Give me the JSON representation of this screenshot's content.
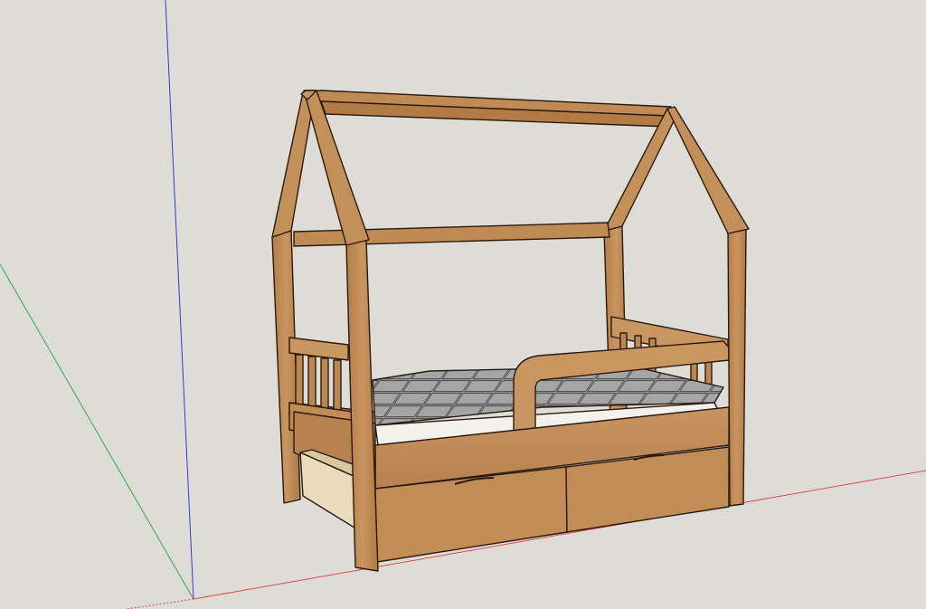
{
  "viewport": {
    "background": "#dddcd7"
  },
  "axes": {
    "x_color": "#d94b4b",
    "y_color": "#3aa64a",
    "z_color": "#2f3fd0"
  },
  "model": {
    "object": "house-frame-bed",
    "wood_light": "#c99560",
    "wood_mid": "#b57d48",
    "wood_dark": "#8e5a2c",
    "edge": "#2a1a0e",
    "mattress_tile": "#9a9a9a",
    "mattress_side": "#f2f1ec"
  }
}
